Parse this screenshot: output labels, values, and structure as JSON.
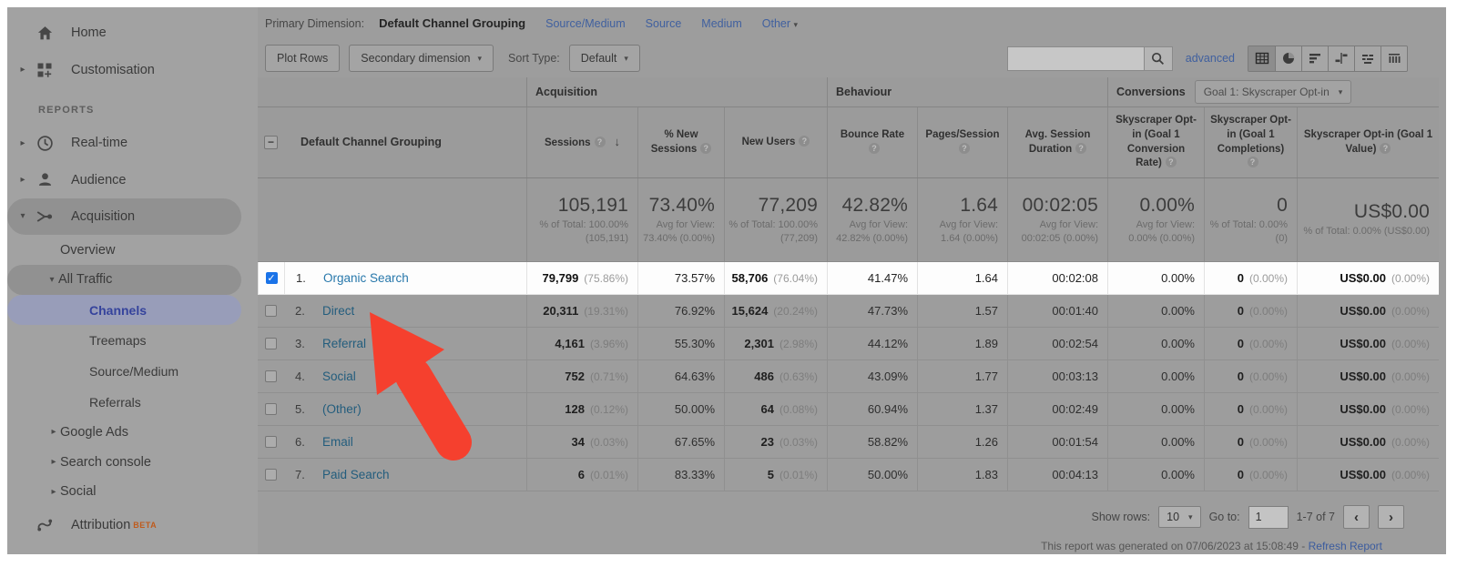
{
  "colors": {
    "highlight_row_bg": "#fdfdfd",
    "link_blue": "#2878ab",
    "sidebar_active_blue": "#35439c",
    "checkbox_blue": "#1a73e8",
    "annotation_arrow_red": "#f5402e",
    "beta_orange": "#bf5b1d"
  },
  "sidebar": {
    "home": "Home",
    "customisation": "Customisation",
    "reports_label": "REPORTS",
    "realtime": "Real-time",
    "audience": "Audience",
    "acquisition": "Acquisition",
    "overview": "Overview",
    "all_traffic": "All Traffic",
    "channels": "Channels",
    "treemaps": "Treemaps",
    "source_medium": "Source/Medium",
    "referrals": "Referrals",
    "google_ads": "Google Ads",
    "search_console": "Search console",
    "social": "Social",
    "attribution": "Attribution",
    "attribution_badge": "BETA"
  },
  "primary_bar": {
    "label": "Primary Dimension:",
    "selected": "Default Channel Grouping",
    "links": [
      "Source/Medium",
      "Source",
      "Medium",
      "Other"
    ]
  },
  "toolbar": {
    "plot_rows": "Plot Rows",
    "secondary_dimension": "Secondary dimension",
    "sort_type_label": "Sort Type:",
    "sort_type_value": "Default",
    "search_value": "",
    "advanced": "advanced"
  },
  "table": {
    "groups": {
      "acquisition": "Acquisition",
      "behaviour": "Behaviour",
      "conversions": "Conversions",
      "goal_selector": "Goal 1: Skyscraper Opt-in"
    },
    "columns": {
      "dimension": "Default Channel Grouping",
      "sessions": "Sessions",
      "new_sessions": "% New Sessions",
      "new_users": "New Users",
      "bounce_rate": "Bounce Rate",
      "pages_session": "Pages/Session",
      "avg_duration": "Avg. Session Duration",
      "goal_rate": "Skyscraper Opt-in (Goal 1 Conversion Rate)",
      "goal_completions": "Skyscraper Opt-in (Goal 1 Completions)",
      "goal_value": "Skyscraper Opt-in (Goal 1 Value)"
    },
    "totals": {
      "sessions": "105,191",
      "sessions_sub": "% of Total: 100.00% (105,191)",
      "new_sessions": "73.40%",
      "new_sessions_sub": "Avg for View: 73.40% (0.00%)",
      "new_users": "77,209",
      "new_users_sub": "% of Total: 100.00% (77,209)",
      "bounce": "42.82%",
      "bounce_sub": "Avg for View: 42.82% (0.00%)",
      "pages": "1.64",
      "pages_sub": "Avg for View: 1.64 (0.00%)",
      "duration": "00:02:05",
      "duration_sub": "Avg for View: 00:02:05 (0.00%)",
      "goal_rate": "0.00%",
      "goal_rate_sub": "Avg for View: 0.00% (0.00%)",
      "goal_completions": "0",
      "goal_completions_sub": "% of Total: 0.00% (0)",
      "goal_value": "US$0.00",
      "goal_value_sub": "% of Total: 0.00% (US$0.00)"
    },
    "rows": [
      {
        "num": "1.",
        "name": "Organic Search",
        "sessions": "79,799",
        "sessions_pct": "(75.86%)",
        "new_sessions": "73.57%",
        "new_users": "58,706",
        "new_users_pct": "(76.04%)",
        "bounce": "41.47%",
        "pages": "1.64",
        "duration": "00:02:08",
        "goal_rate": "0.00%",
        "goal_completions": "0",
        "goal_completions_pct": "(0.00%)",
        "goal_value": "US$0.00",
        "goal_value_pct": "(0.00%)"
      },
      {
        "num": "2.",
        "name": "Direct",
        "sessions": "20,311",
        "sessions_pct": "(19.31%)",
        "new_sessions": "76.92%",
        "new_users": "15,624",
        "new_users_pct": "(20.24%)",
        "bounce": "47.73%",
        "pages": "1.57",
        "duration": "00:01:40",
        "goal_rate": "0.00%",
        "goal_completions": "0",
        "goal_completions_pct": "(0.00%)",
        "goal_value": "US$0.00",
        "goal_value_pct": "(0.00%)"
      },
      {
        "num": "3.",
        "name": "Referral",
        "sessions": "4,161",
        "sessions_pct": "(3.96%)",
        "new_sessions": "55.30%",
        "new_users": "2,301",
        "new_users_pct": "(2.98%)",
        "bounce": "44.12%",
        "pages": "1.89",
        "duration": "00:02:54",
        "goal_rate": "0.00%",
        "goal_completions": "0",
        "goal_completions_pct": "(0.00%)",
        "goal_value": "US$0.00",
        "goal_value_pct": "(0.00%)"
      },
      {
        "num": "4.",
        "name": "Social",
        "sessions": "752",
        "sessions_pct": "(0.71%)",
        "new_sessions": "64.63%",
        "new_users": "486",
        "new_users_pct": "(0.63%)",
        "bounce": "43.09%",
        "pages": "1.77",
        "duration": "00:03:13",
        "goal_rate": "0.00%",
        "goal_completions": "0",
        "goal_completions_pct": "(0.00%)",
        "goal_value": "US$0.00",
        "goal_value_pct": "(0.00%)"
      },
      {
        "num": "5.",
        "name": "(Other)",
        "sessions": "128",
        "sessions_pct": "(0.12%)",
        "new_sessions": "50.00%",
        "new_users": "64",
        "new_users_pct": "(0.08%)",
        "bounce": "60.94%",
        "pages": "1.37",
        "duration": "00:02:49",
        "goal_rate": "0.00%",
        "goal_completions": "0",
        "goal_completions_pct": "(0.00%)",
        "goal_value": "US$0.00",
        "goal_value_pct": "(0.00%)"
      },
      {
        "num": "6.",
        "name": "Email",
        "sessions": "34",
        "sessions_pct": "(0.03%)",
        "new_sessions": "67.65%",
        "new_users": "23",
        "new_users_pct": "(0.03%)",
        "bounce": "58.82%",
        "pages": "1.26",
        "duration": "00:01:54",
        "goal_rate": "0.00%",
        "goal_completions": "0",
        "goal_completions_pct": "(0.00%)",
        "goal_value": "US$0.00",
        "goal_value_pct": "(0.00%)"
      },
      {
        "num": "7.",
        "name": "Paid Search",
        "sessions": "6",
        "sessions_pct": "(0.01%)",
        "new_sessions": "83.33%",
        "new_users": "5",
        "new_users_pct": "(0.01%)",
        "bounce": "50.00%",
        "pages": "1.83",
        "duration": "00:04:13",
        "goal_rate": "0.00%",
        "goal_completions": "0",
        "goal_completions_pct": "(0.00%)",
        "goal_value": "US$0.00",
        "goal_value_pct": "(0.00%)"
      }
    ]
  },
  "pagination": {
    "show_rows_label": "Show rows:",
    "show_rows_value": "10",
    "goto_label": "Go to:",
    "goto_value": "1",
    "range": "1-7 of 7"
  },
  "footer": {
    "generated_text": "This report was generated on 07/06/2023 at 15:08:49 -",
    "refresh_link": "Refresh Report"
  }
}
